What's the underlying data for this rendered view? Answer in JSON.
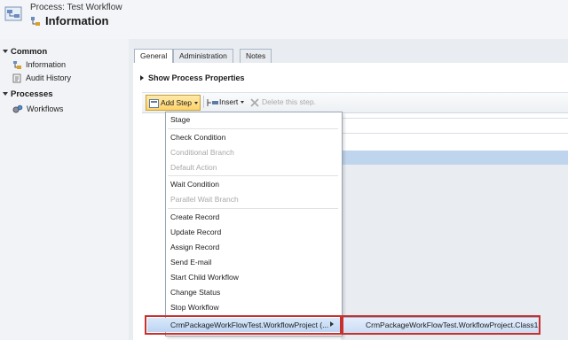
{
  "header": {
    "process_label": "Process: Test Workflow",
    "title": "Information"
  },
  "nav": {
    "sections": [
      {
        "label": "Common",
        "items": [
          {
            "label": "Information",
            "icon": "form-icon"
          },
          {
            "label": "Audit History",
            "icon": "audit-history-icon"
          }
        ]
      },
      {
        "label": "Processes",
        "items": [
          {
            "label": "Workflows",
            "icon": "workflow-gears-icon"
          }
        ]
      }
    ]
  },
  "tabs": [
    {
      "label": "General",
      "active": true
    },
    {
      "label": "Administration",
      "active": false
    },
    {
      "label": "Notes",
      "active": false
    }
  ],
  "section": {
    "show_properties": "Show Process Properties"
  },
  "toolbar": {
    "add_step": "Add Step",
    "insert": "Insert",
    "delete": "Delete this step."
  },
  "menu": {
    "items": [
      {
        "label": "Stage",
        "enabled": true
      },
      {
        "label": "Check Condition",
        "enabled": true
      },
      {
        "label": "Conditional Branch",
        "enabled": false
      },
      {
        "label": "Default Action",
        "enabled": false
      },
      {
        "label": "Wait Condition",
        "enabled": true
      },
      {
        "label": "Parallel Wait Branch",
        "enabled": false
      },
      {
        "label": "Create Record",
        "enabled": true
      },
      {
        "label": "Update Record",
        "enabled": true
      },
      {
        "label": "Assign Record",
        "enabled": true
      },
      {
        "label": "Send E-mail",
        "enabled": true
      },
      {
        "label": "Start Child Workflow",
        "enabled": true
      },
      {
        "label": "Change Status",
        "enabled": true
      },
      {
        "label": "Stop Workflow",
        "enabled": true
      }
    ],
    "plugin_item": "CrmPackageWorkFlowTest.WorkflowProject (...",
    "submenu_item": "CrmPackageWorkFlowTest.WorkflowProject.Class1"
  },
  "colors": {
    "highlight_border": "#c9302c",
    "add_step_bg": "#ffd36b",
    "selected_row": "#bfd5ee"
  }
}
